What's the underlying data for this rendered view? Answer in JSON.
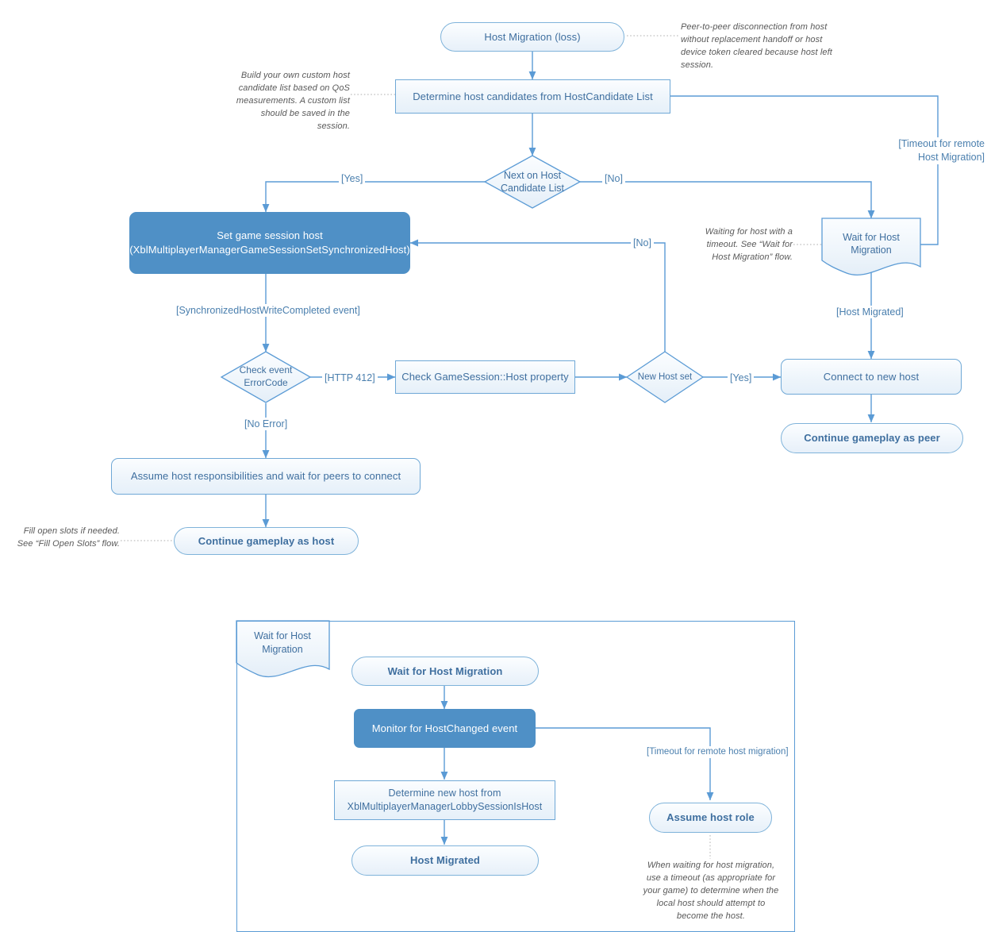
{
  "diagram": {
    "title": "Host Migration (loss) flow",
    "colors": {
      "accent": "#4f90c6",
      "line": "#5b9bd5",
      "text": "#3f6f9f",
      "note": "#595959",
      "box_fill": "#eef5fb"
    }
  },
  "main_flow": {
    "nodes": {
      "start": "Host Migration (loss)",
      "determine_candidates": "Determine host candidates from HostCandidate List",
      "next_candidate": "Next on Host\nCandidate List",
      "next_candidate_l1": "Next on Host",
      "next_candidate_l2": "Candidate List",
      "set_session_host_l1": "Set game session host",
      "set_session_host_l2": "(XblMultiplayerManagerGameSessionSetSynchronizedHost)",
      "wait_host_migration_l1": "Wait for Host",
      "wait_host_migration_l2": "Migration",
      "check_error_l1": "Check event",
      "check_error_l2": "ErrorCode",
      "check_host_property": "Check GameSession::Host property",
      "new_host_set": "New Host set",
      "connect_new_host": "Connect to new host",
      "continue_as_peer": "Continue gameplay as peer",
      "assume_host": "Assume host responsibilities and wait for peers to connect",
      "continue_as_host": "Continue gameplay as host"
    },
    "edge_labels": {
      "yes_candidate": "[Yes]",
      "no_candidate": "[No]",
      "timeout_remote": "[Timeout for remote\nHost Migration]",
      "timeout_remote_l1": "[Timeout for remote",
      "timeout_remote_l2": "Host Migration]",
      "sync_host_write": "[SynchronizedHostWriteCompleted event]",
      "http_412": "[HTTP 412]",
      "no_error": "[No Error]",
      "no_new_host": "[No]",
      "yes_new_host": "[Yes]",
      "host_migrated": "[Host Migrated]"
    },
    "notes": {
      "start_note": "Peer-to-peer disconnection from host without replacement handoff or host device token cleared because host left session.",
      "candidates_note": "Build your own custom host candidate list based on QoS measurements. A custom list should be saved in the session.",
      "wait_note": "Waiting for host with a timeout. See “Wait for Host Migration” flow.",
      "fill_slots_note": "Fill open slots if needed. See “Fill Open Slots” flow."
    }
  },
  "sub_flow": {
    "container_title_l1": "Wait for Host",
    "container_title_l2": "Migration",
    "nodes": {
      "start": "Wait for Host Migration",
      "monitor": "Monitor for HostChanged event",
      "determine_new_host_l1": "Determine new host from",
      "determine_new_host_l2": "XblMultiplayerManagerLobbySessionIsHost",
      "host_migrated": "Host Migrated",
      "assume_host_role": "Assume host role"
    },
    "edge_labels": {
      "timeout_remote": "[Timeout for remote host migration]"
    },
    "notes": {
      "timeout_note": "When waiting for host migration, use a timeout (as appropriate for your game) to determine when the local host should attempt to become the host."
    }
  }
}
